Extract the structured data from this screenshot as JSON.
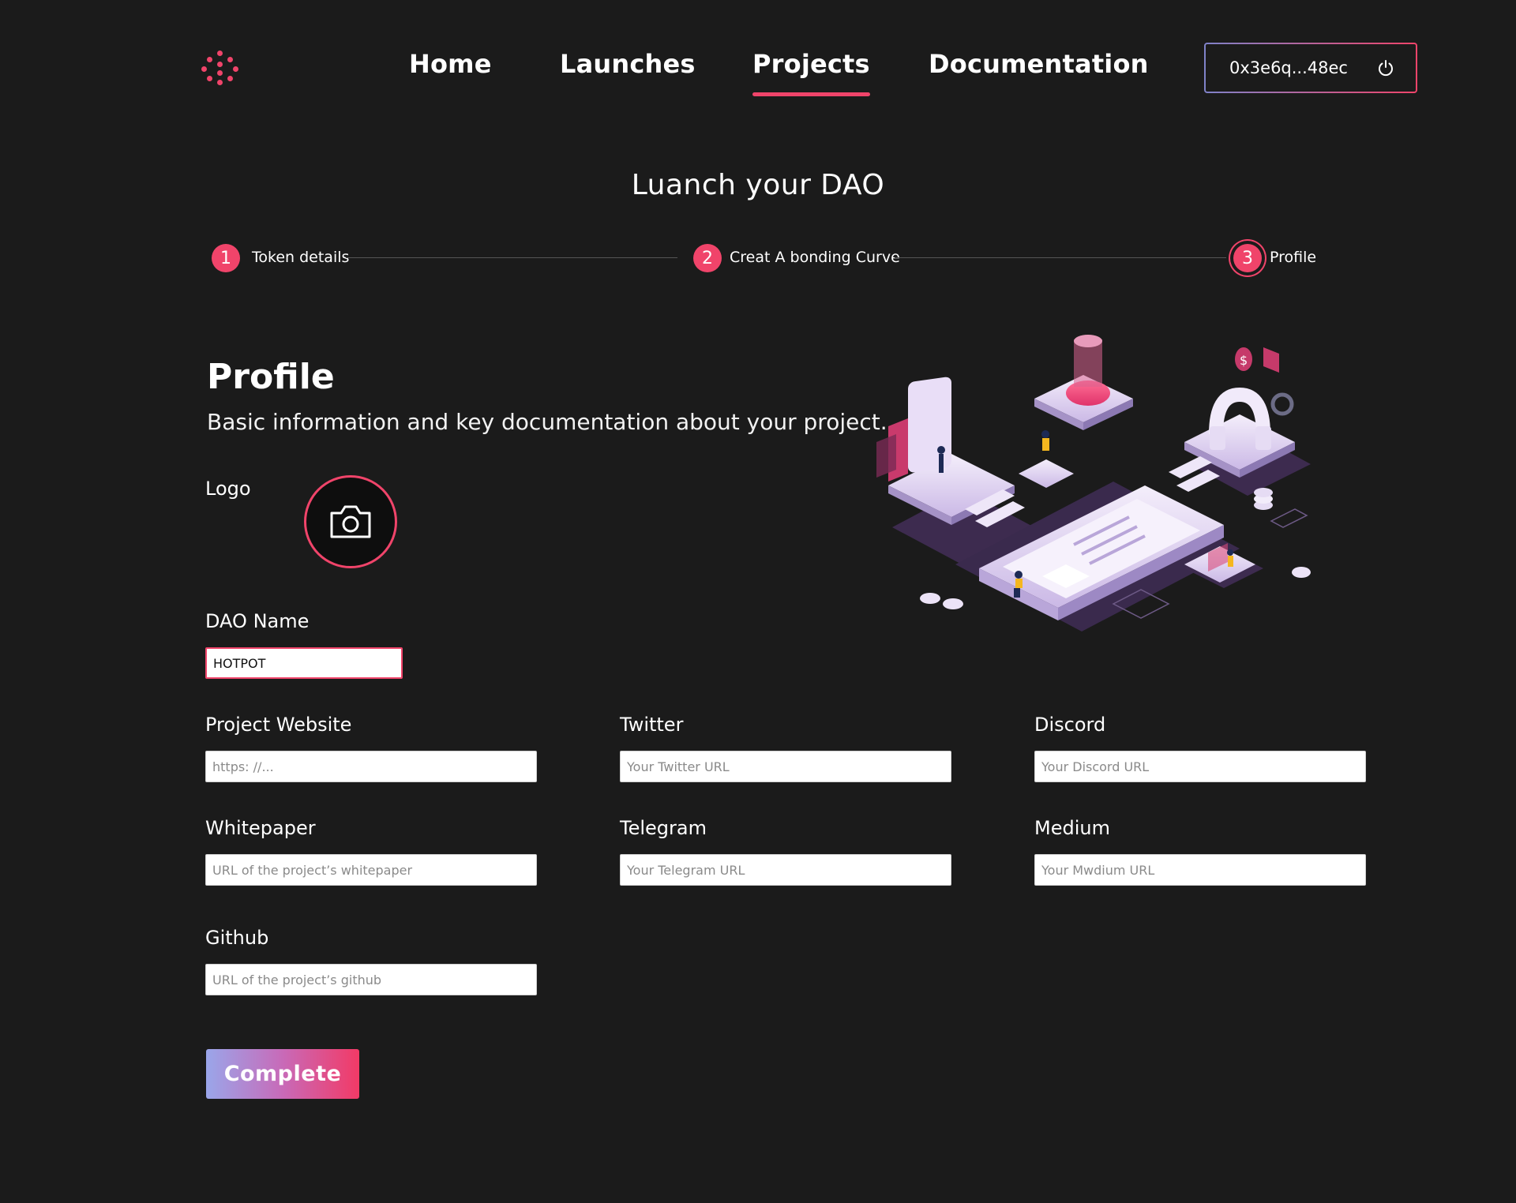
{
  "header": {
    "nav": [
      "Home",
      "Launches",
      "Projects",
      "Documentation"
    ],
    "active_nav": "Projects",
    "wallet_address": "0x3e6q...48ec",
    "wallet_icon": "power-icon"
  },
  "page": {
    "title": "Luanch your DAO"
  },
  "stepper": {
    "steps": [
      {
        "number": "1",
        "label": "Token details"
      },
      {
        "number": "2",
        "label": "Creat A bonding Curve"
      },
      {
        "number": "3",
        "label": "Profile"
      }
    ],
    "current_step": 3
  },
  "profile": {
    "heading": "Profile",
    "subheading": "Basic information and key documentation about your project.",
    "logo_label": "Logo",
    "logo_icon": "camera-icon",
    "dao_name": {
      "label": "DAO Name",
      "value": "HOTPOT"
    },
    "project_website": {
      "label": "Project Website",
      "placeholder": "https: //..."
    },
    "twitter": {
      "label": "Twitter",
      "placeholder": "Your Twitter URL"
    },
    "discord": {
      "label": "Discord",
      "placeholder": "Your Discord URL"
    },
    "whitepaper": {
      "label": "Whitepaper",
      "placeholder": "URL of the project’s whitepaper"
    },
    "telegram": {
      "label": "Telegram",
      "placeholder": "Your Telegram URL"
    },
    "medium": {
      "label": "Medium",
      "placeholder": "Your Mwdium URL"
    },
    "github": {
      "label": "Github",
      "placeholder": "URL of the project’s github"
    },
    "complete_button": "Complete"
  },
  "colors": {
    "background": "#1b1b1b",
    "accent": "#f0446a",
    "button_gradient_start": "#9aa6ea",
    "button_gradient_end": "#f23a66"
  }
}
